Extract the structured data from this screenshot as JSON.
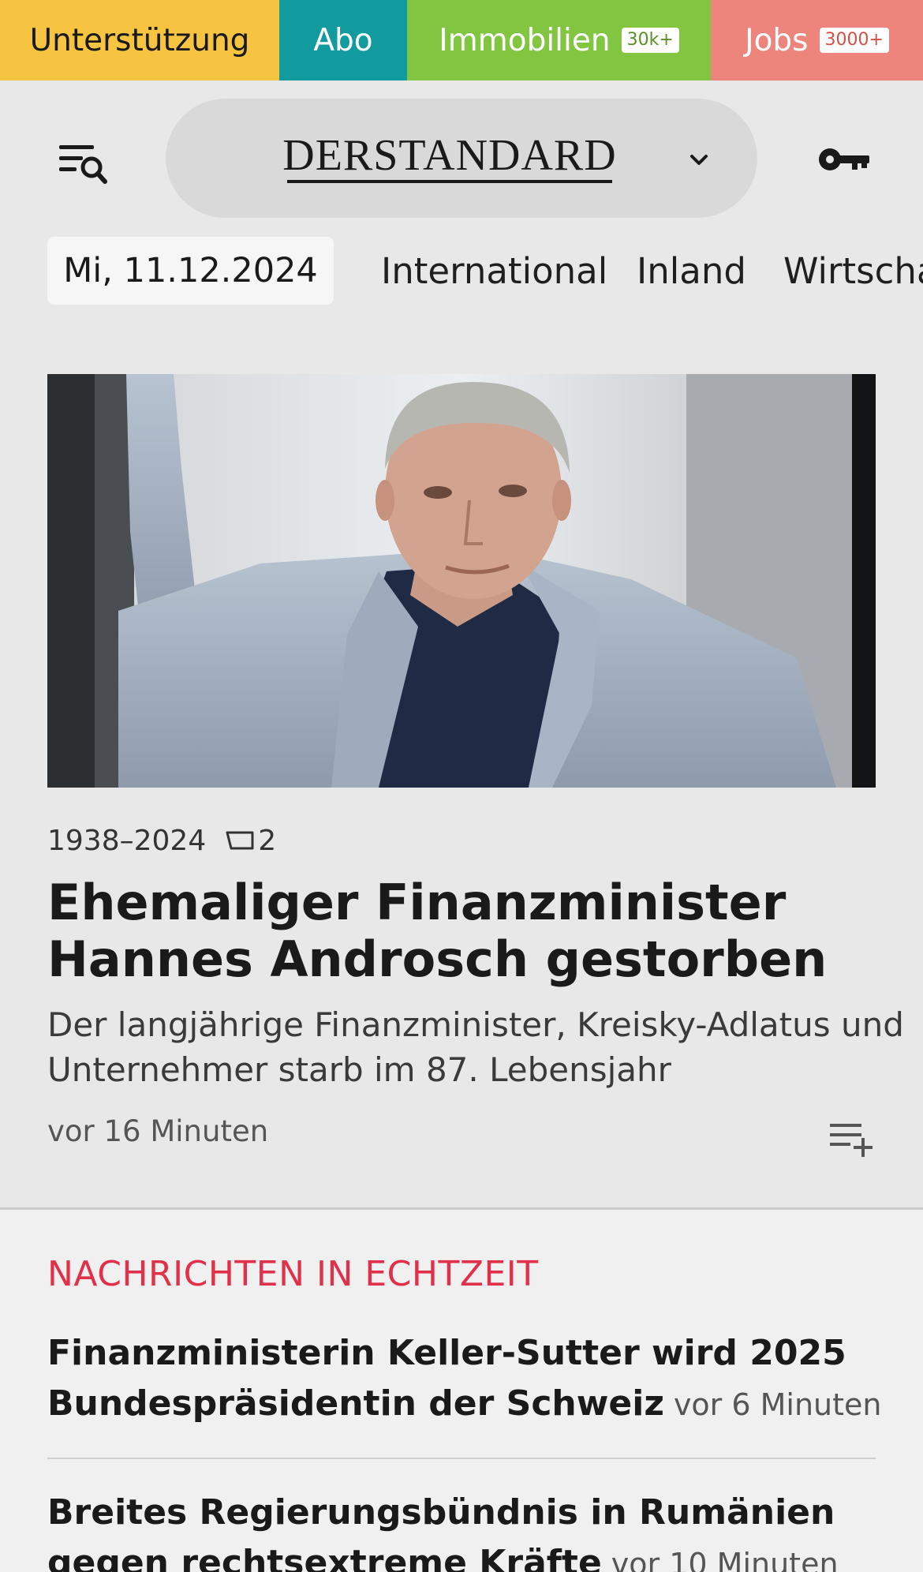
{
  "topbar": {
    "support": "Unterstützung",
    "abo": "Abo",
    "immobilien": "Immobilien",
    "immobilien_badge": "30k+",
    "jobs": "Jobs",
    "jobs_badge": "3000+"
  },
  "header": {
    "logo_der": "DER",
    "logo_standard": "STANDARD"
  },
  "nav": {
    "date": "Mi, 11.12.2024",
    "items": [
      "International",
      "Inland",
      "Wirtschaft"
    ]
  },
  "hero": {
    "kicker": "1938–2024",
    "comment_count": "2",
    "title": "Ehemaliger Finanzminister Hannes Androsch gestorben",
    "teaser": "Der langjährige Finanzminister, Kreisky-Adlatus und Unternehmer starb im 87. Lebensjahr",
    "time": "vor 16 Minuten"
  },
  "live": {
    "heading": "NACHRICHTEN IN ECHTZEIT",
    "items": [
      {
        "title": "Finanzministerin Keller-Sutter wird 2025 Bundes­präsidentin der Schweiz",
        "time": "vor 6 Minuten"
      },
      {
        "title": "Breites Regierungsbündnis in Rumänien gegen rechtsextreme Kräfte",
        "time": "vor 10 Minuten"
      }
    ]
  },
  "colors": {
    "support": "#f7c442",
    "abo": "#119b9e",
    "immobilien": "#82c540",
    "jobs": "#ee857c",
    "live_heading": "#e0304a"
  }
}
